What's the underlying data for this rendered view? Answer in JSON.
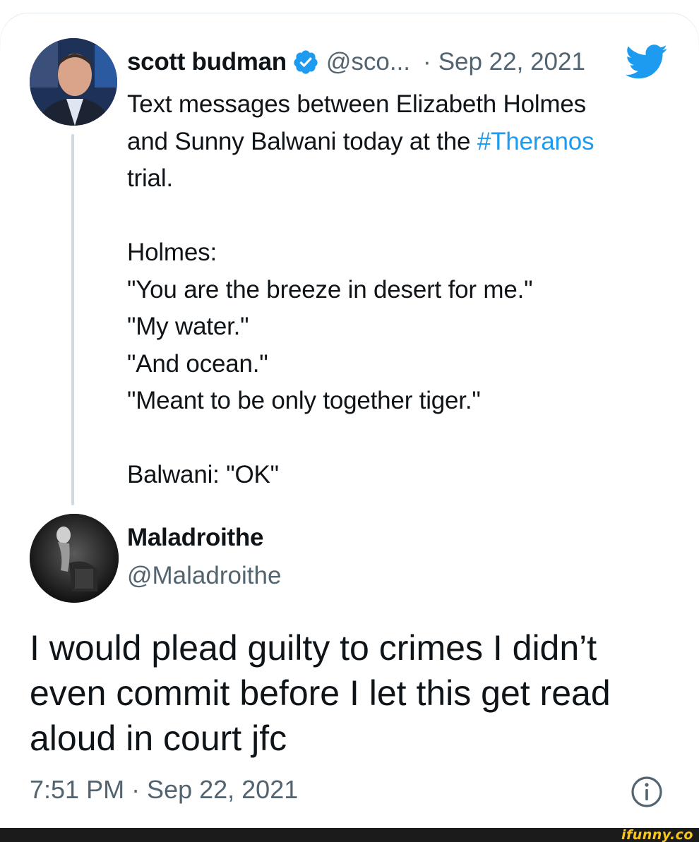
{
  "quoted_tweet": {
    "author_name": "scott budman",
    "handle": "@sco...",
    "separator": "·",
    "date": "Sep 22, 2021",
    "body_lines": [
      {
        "parts": [
          {
            "text": "Text messages between Elizabeth Holmes",
            "hashtag": false
          }
        ]
      },
      {
        "parts": [
          {
            "text": "and Sunny Balwani today at the ",
            "hashtag": false
          },
          {
            "text": "#Theranos",
            "hashtag": true
          }
        ]
      },
      {
        "parts": [
          {
            "text": "trial.",
            "hashtag": false
          }
        ]
      },
      {
        "gap": true
      },
      {
        "parts": [
          {
            "text": "Holmes:",
            "hashtag": false
          }
        ]
      },
      {
        "parts": [
          {
            "text": "\"You are the breeze in desert for me.\"",
            "hashtag": false
          }
        ]
      },
      {
        "parts": [
          {
            "text": "\"My water.\"",
            "hashtag": false
          }
        ]
      },
      {
        "parts": [
          {
            "text": "\"And ocean.\"",
            "hashtag": false
          }
        ]
      },
      {
        "parts": [
          {
            "text": "\"Meant to be only together tiger.\"",
            "hashtag": false
          }
        ]
      },
      {
        "gap": true
      },
      {
        "parts": [
          {
            "text": "Balwani: \"OK\"",
            "hashtag": false
          }
        ]
      }
    ]
  },
  "reply_tweet": {
    "author_name": "Maladroithe",
    "handle": "@Maladroithe",
    "body_lines": [
      "I would plead guilty to crimes I didn’t",
      "even commit before I let this get read",
      "aloud in court jfc"
    ],
    "timestamp": "7:51 PM · Sep 22, 2021"
  },
  "colors": {
    "link_blue": "#1d9bf0",
    "secondary_gray": "#536471",
    "primary_text": "#0f1419"
  },
  "icons": {
    "verified": "verified-badge-icon",
    "bird": "twitter-bird-icon",
    "info": "info-icon"
  },
  "watermark": "ifunny.co"
}
